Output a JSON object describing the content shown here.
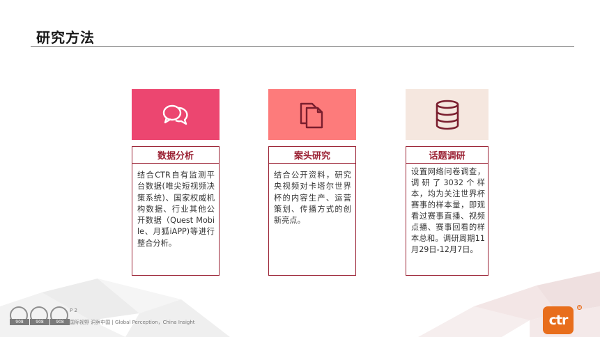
{
  "title": "研究方法",
  "colors": {
    "accent": "#9b2335",
    "card1_bg": "#ec4670",
    "card2_bg": "#fd7b7b",
    "card3_bg": "#f5e7df",
    "logo": "#e86e1c"
  },
  "cards": [
    {
      "icon": "chat-bubbles-icon",
      "heading": "数据分析",
      "text": "结合CTR自有监测平台数据(唯尖短视频决策系统)、国家权威机构数据、行业其他公开数据（Quest Mobile、月狐iAPP)等进行整合分析。"
    },
    {
      "icon": "documents-icon",
      "heading": "案头研究",
      "text": "结合公开资料，研究央视频对卡塔尔世界杯的内容生产、运营策划、传播方式的创新亮点。"
    },
    {
      "icon": "database-icon",
      "heading": "话题调研",
      "text": "设置网络问卷调查，调研了3032个样本，均为关注世界杯赛事的样本量，即观看过赛事直播、视频点播、赛事回看的样本总和。调研周期11月29日-12月7日。"
    }
  ],
  "footer": {
    "badges": [
      "908",
      "908",
      "908"
    ],
    "page": "P 2",
    "tagline": "国际视野  洞察中国 |  Global Perception，China Insight"
  },
  "logo": {
    "text": "ctr",
    "mark": "®"
  }
}
